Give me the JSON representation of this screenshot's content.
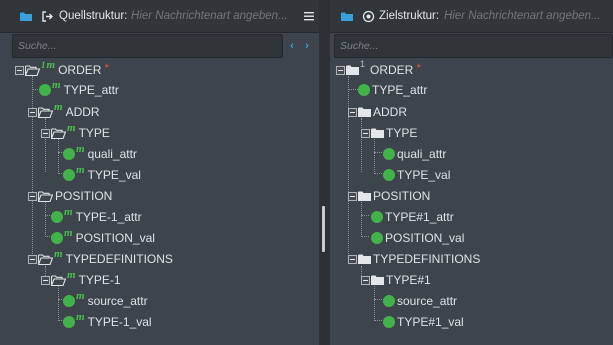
{
  "source": {
    "title": "Quellstruktur:",
    "placeholder": "Hier Nachrichtenart angeben...",
    "search_placeholder": "Suche...",
    "prev_arrow": "‹",
    "next_arrow": "›",
    "root_sup": "1",
    "mark": "m",
    "required_mark": "*",
    "nodes": {
      "order": "ORDER",
      "type_attr": "TYPE_attr",
      "addr": "ADDR",
      "type": "TYPE",
      "quali_attr": "quali_attr",
      "type_val": "TYPE_val",
      "position": "POSITION",
      "type1_attr": "TYPE-1_attr",
      "position_val": "POSITION_val",
      "typedefinitions": "TYPEDEFINITIONS",
      "type1": "TYPE-1",
      "source_attr": "source_attr",
      "type1_val": "TYPE-1_val"
    }
  },
  "target": {
    "title": "Zielstruktur:",
    "placeholder": "Hier Nachrichtenart angeben...",
    "search_placeholder": "Suche...",
    "root_sup": "1",
    "required_mark": "*",
    "nodes": {
      "order": "ORDER",
      "type_attr": "TYPE_attr",
      "addr": "ADDR",
      "type": "TYPE",
      "quali_attr": "quali_attr",
      "type_val": "TYPE_val",
      "position": "POSITION",
      "type1_attr": "TYPE#1_attr",
      "position_val": "POSITION_val",
      "typedefinitions": "TYPEDEFINITIONS",
      "type1": "TYPE#1",
      "source_attr": "source_attr",
      "type1_val": "TYPE#1_val"
    }
  },
  "colors": {
    "background": "#3e444b",
    "header": "#31363b",
    "accent_blue": "#3aa0dd",
    "mapped_green": "#42b34b",
    "required_red": "#d9534f"
  },
  "icons": {
    "folder": "folder-icon",
    "source_action": "open-in-icon",
    "target_action": "target-circle-icon",
    "menu": "hamburger-menu-icon",
    "open_folder": "folder-open-icon",
    "closed_folder": "folder-closed-icon",
    "leaf": "green-dot-icon"
  }
}
